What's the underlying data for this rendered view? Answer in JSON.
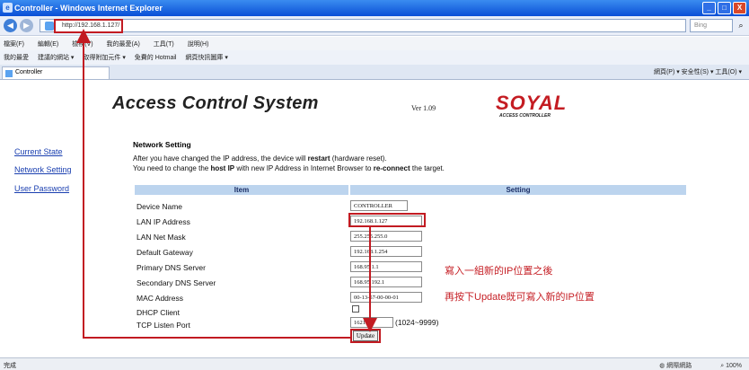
{
  "window": {
    "title": "Controller - Windows Internet Explorer",
    "min": "_",
    "max": "□",
    "close": "X"
  },
  "address": {
    "url": "http://192.168.1.127/",
    "search_placeholder": "Bing"
  },
  "menu": [
    "檔案(F)",
    "編輯(E)",
    "檢視(V)",
    "我的最愛(A)",
    "工具(T)",
    "說明(H)"
  ],
  "favorites": [
    "我的最愛",
    "建議的網站 ▾",
    "取得附加元件 ▾",
    "免費的 Hotmail",
    "網頁快訊圖庫 ▾"
  ],
  "tab": {
    "label": "Controller",
    "commands": "網頁(P) ▾  安全性(S) ▾  工具(O) ▾"
  },
  "header": {
    "app_title": "Access Control System",
    "version": "Ver 1.09",
    "logo_main": "SOYAL",
    "logo_sub": "ACCESS CONTROLLER"
  },
  "sidebar": [
    {
      "label": "Current State"
    },
    {
      "label": "Network Setting"
    },
    {
      "label": "User Password"
    }
  ],
  "section": {
    "title": "Network Setting",
    "notice1_pre": "After you have changed the IP address, the device will ",
    "notice1_bold": "restart",
    "notice1_post": " (hardware reset).",
    "notice2_pre": "You need to change the ",
    "notice2_bold1": "host IP",
    "notice2_mid": " with new IP Address in Internet Browser to ",
    "notice2_bold2": "re-connect",
    "notice2_post": " the target."
  },
  "table": {
    "col_item": "Item",
    "col_setting": "Setting",
    "rows": [
      {
        "label": "Device Name",
        "value": "CONTROLLER"
      },
      {
        "label": "LAN IP Address",
        "value": "192.168.1.127"
      },
      {
        "label": "LAN Net Mask",
        "value": "255.255.255.0"
      },
      {
        "label": "Default Gateway",
        "value": "192.168.1.254"
      },
      {
        "label": "Primary DNS Server",
        "value": "168.95.1.1"
      },
      {
        "label": "Secondary DNS Server",
        "value": "168.95.192.1"
      },
      {
        "label": "MAC Address",
        "value": "00-13-57-00-00-01"
      },
      {
        "label": "DHCP Client",
        "value": ""
      },
      {
        "label": "TCP Listen Port",
        "value": "1621"
      }
    ],
    "port_range": "(1024~9999)",
    "update_label": "Update"
  },
  "annotations": [
    "寫入一組新的IP位置之後",
    "再按下Update既可寫入新的IP位置"
  ],
  "status": {
    "left": "完成",
    "zone": "網際網路",
    "zoom": "100%"
  },
  "colors": {
    "highlight": "#c21b22",
    "note_text": "#c62127",
    "table_header": "#bcd4ee",
    "link": "#1a3fb0"
  }
}
